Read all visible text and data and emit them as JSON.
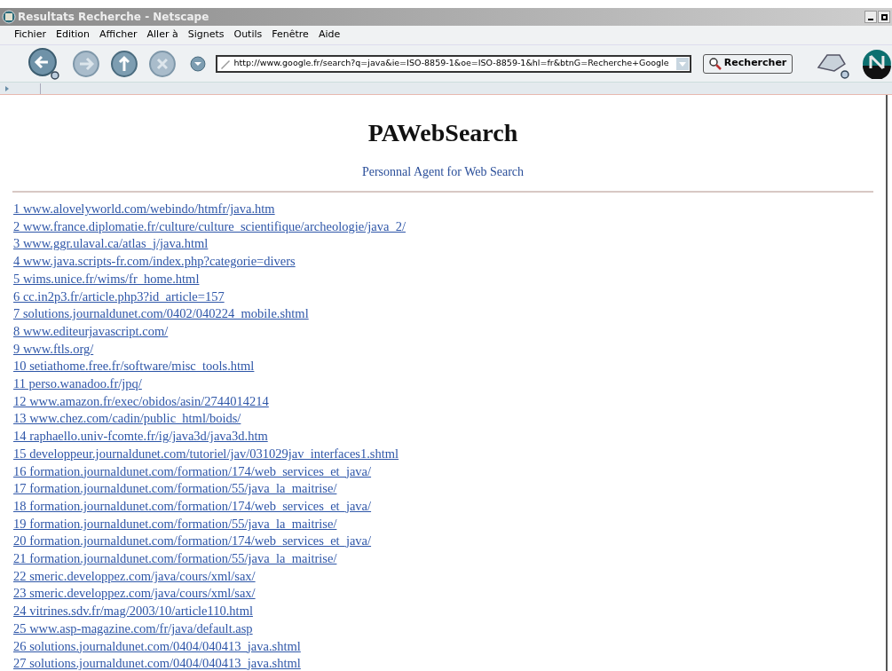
{
  "window": {
    "title": "Resultats Recherche - Netscape"
  },
  "menu": [
    "Fichier",
    "Edition",
    "Afficher",
    "Aller à",
    "Signets",
    "Outils",
    "Fenêtre",
    "Aide"
  ],
  "toolbar": {
    "address": "http://www.google.fr/search?q=java&ie=ISO-8859-1&oe=ISO-8859-1&hl=fr&btnG=Recherche+Google",
    "search_button": "Rechercher"
  },
  "page": {
    "heading": "PAWebSearch",
    "subtitle": "Personnal Agent for Web Search",
    "results": [
      "1 www.alovelyworld.com/webindo/htmfr/java.htm",
      "2 www.france.diplomatie.fr/culture/culture_scientifique/archeologie/java_2/",
      "3 www.ggr.ulaval.ca/atlas_j/java.html",
      "4 www.java.scripts-fr.com/index.php?categorie=divers",
      "5 wims.unice.fr/wims/fr_home.html",
      "6 cc.in2p3.fr/article.php3?id_article=157",
      "7 solutions.journaldunet.com/0402/040224_mobile.shtml",
      "8 www.editeurjavascript.com/",
      "9 www.ftls.org/",
      "10 setiathome.free.fr/software/misc_tools.html",
      "11 perso.wanadoo.fr/jpq/",
      "12 www.amazon.fr/exec/obidos/asin/2744014214",
      "13 www.chez.com/cadin/public_html/boids/",
      "14 raphaello.univ-fcomte.fr/ig/java3d/java3d.htm",
      "15 developpeur.journaldunet.com/tutoriel/jav/031029jav_interfaces1.shtml",
      "16 formation.journaldunet.com/formation/174/web_services_et_java/",
      "17 formation.journaldunet.com/formation/55/java_la_maitrise/",
      "18 formation.journaldunet.com/formation/174/web_services_et_java/",
      "19 formation.journaldunet.com/formation/55/java_la_maitrise/",
      "20 formation.journaldunet.com/formation/174/web_services_et_java/",
      "21 formation.journaldunet.com/formation/55/java_la_maitrise/",
      "22 smeric.developpez.com/java/cours/xml/sax/",
      "23 smeric.developpez.com/java/cours/xml/sax/",
      "24 vitrines.sdv.fr/mag/2003/10/article110.html",
      "25 www.asp-magazine.com/fr/java/default.asp",
      "26 solutions.journaldunet.com/0404/040413_java.shtml",
      "27 solutions.journaldunet.com/0404/040413_java.shtml"
    ]
  }
}
